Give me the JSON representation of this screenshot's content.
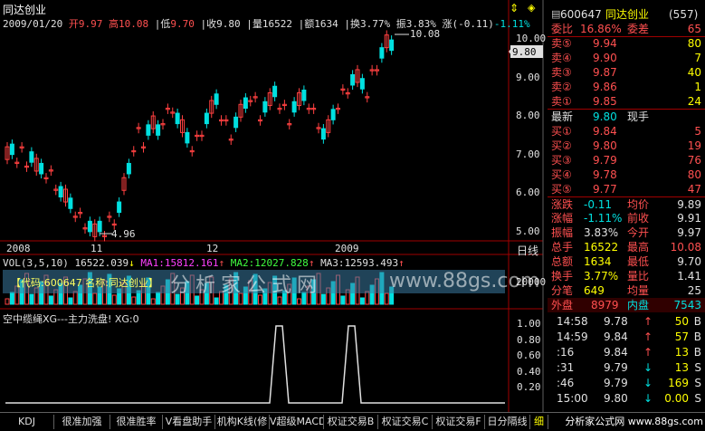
{
  "header": {
    "title": "同达创业",
    "date": "2009/01/20",
    "open_label": "开",
    "open": "9.97",
    "high_label": "高",
    "high": "10.08",
    "low_label": "低",
    "low": "9.70",
    "close_label": "收",
    "close": "9.80",
    "vol_label": "量",
    "vol": "16522",
    "amount_label": "额",
    "amount": "1634",
    "turnover_label": "换",
    "turnover": "3.77%",
    "amplitude_label": "振",
    "amplitude": "3.83%",
    "change_label": "涨",
    "change": "(-0.11)",
    "change_pct": "-1.11%"
  },
  "price_axis": [
    "10.00",
    "9.00",
    "8.00",
    "7.00",
    "6.00",
    "5.00"
  ],
  "price_tag": "9.80",
  "annot_high": "10.08",
  "annot_low": "4.96",
  "date_axis": [
    "2008",
    "11",
    "12",
    "2009"
  ],
  "period_label": "日线",
  "vol_panel": {
    "title": "VOL(3,5,10)",
    "v": "16522.039",
    "ma1_label": "MA1:",
    "ma1": "15812.161",
    "ma2_label": "MA2:",
    "ma2": "12027.828",
    "ma3_label": "MA3:",
    "ma3": "12593.493",
    "axis_top": "20000",
    "info_text": "【代码:600647  名称:同达创业】",
    "watermark": "分析家公式网",
    "watermark_url": "www.88gs.com"
  },
  "ind_panel": {
    "title": "空中缆绳XG---主力洗盘! XG:0",
    "axis": [
      "1.00",
      "0.80",
      "0.60",
      "0.40",
      "0.20"
    ]
  },
  "quote": {
    "code": "600647",
    "name": "同达创业",
    "num": "(557)",
    "weibi_label": "委比",
    "weibi": "16.86%",
    "weicha_label": "委差",
    "weicha": "65",
    "sells": [
      {
        "label": "卖⑤",
        "price": "9.94",
        "vol": "80"
      },
      {
        "label": "卖④",
        "price": "9.90",
        "vol": "7"
      },
      {
        "label": "卖③",
        "price": "9.87",
        "vol": "40"
      },
      {
        "label": "卖②",
        "price": "9.86",
        "vol": "1"
      },
      {
        "label": "卖①",
        "price": "9.85",
        "vol": "24"
      }
    ],
    "latest_label": "最新",
    "latest": "9.80",
    "xianshou_label": "现手",
    "buys": [
      {
        "label": "买①",
        "price": "9.84",
        "vol": "5"
      },
      {
        "label": "买②",
        "price": "9.80",
        "vol": "19"
      },
      {
        "label": "买③",
        "price": "9.79",
        "vol": "76"
      },
      {
        "label": "买④",
        "price": "9.78",
        "vol": "80"
      },
      {
        "label": "买⑤",
        "price": "9.77",
        "vol": "47"
      }
    ],
    "stats": [
      {
        "l1": "涨跌",
        "v1": "-0.11",
        "l2": "均价",
        "v2": "9.89"
      },
      {
        "l1": "涨幅",
        "v1": "-1.11%",
        "l2": "前收",
        "v2": "9.91"
      },
      {
        "l1": "振幅",
        "v1": "3.83%",
        "l2": "今开",
        "v2": "9.97"
      },
      {
        "l1": "总手",
        "v1": "16522",
        "l2": "最高",
        "v2": "10.08"
      },
      {
        "l1": "总额",
        "v1": "1634",
        "l2": "最低",
        "v2": "9.70"
      },
      {
        "l1": "换手",
        "v1": "3.77%",
        "l2": "量比",
        "v2": "1.41"
      },
      {
        "l1": "分笔",
        "v1": "649",
        "l2": "均量",
        "v2": "25"
      }
    ],
    "waipan_label": "外盘",
    "waipan": "8979",
    "neipan_label": "内盘",
    "neipan": "7543",
    "ticks": [
      {
        "time": "14:58",
        "price": "9.78",
        "vol": "50",
        "side": "B"
      },
      {
        "time": "14:59",
        "price": "9.84",
        "vol": "57",
        "side": "B"
      },
      {
        "time": ":16",
        "price": "9.84",
        "vol": "13",
        "side": "B"
      },
      {
        "time": ":31",
        "price": "9.79",
        "vol": "13",
        "side": "S"
      },
      {
        "time": ":46",
        "price": "9.79",
        "vol": "169",
        "side": "S"
      },
      {
        "time": "15:00",
        "price": "9.80",
        "vol": "0.00",
        "side": "S"
      }
    ]
  },
  "tabs": [
    "KDJ",
    "很准加强",
    "很准胜率",
    "V看盘助手",
    "机构K线(修",
    "V超级MACD",
    "权证交易B",
    "权证交易C",
    "权证交易F",
    "日分隔线",
    "细"
  ],
  "footer_watermark": "分析家公式网 www.88gs.com",
  "colors": {
    "up": "#ff4040",
    "down": "#00e0e0",
    "ma": "#e0e000",
    "grid": "#800000"
  }
}
